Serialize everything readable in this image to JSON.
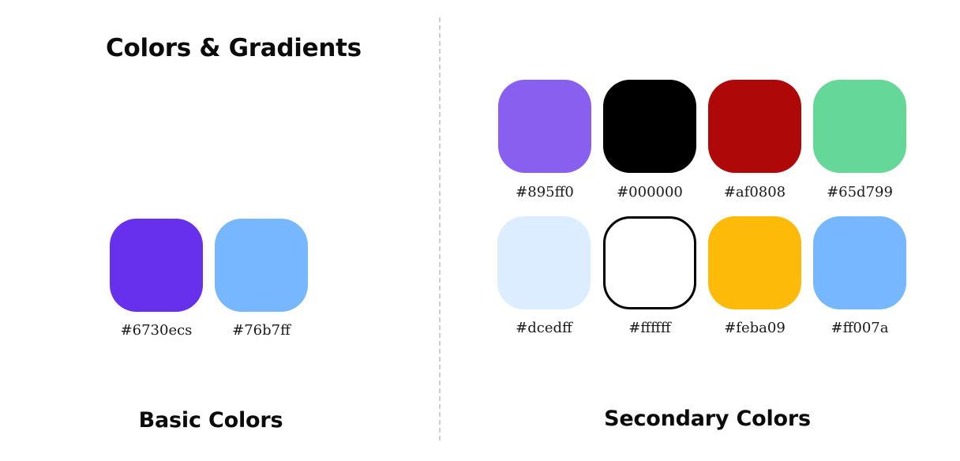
{
  "page": {
    "title": "Colors & Gradients"
  },
  "basic": {
    "heading": "Basic Colors",
    "swatches": [
      {
        "label": "#6730ecs",
        "color": "#6730ec"
      },
      {
        "label": "#76b7ff",
        "color": "#76b7ff"
      }
    ]
  },
  "secondary": {
    "heading": "Secondary Colors",
    "swatches": [
      {
        "label": "#895ff0",
        "color": "#895ff0"
      },
      {
        "label": "#000000",
        "color": "#000000"
      },
      {
        "label": "#af0808",
        "color": "#af0808"
      },
      {
        "label": "#65d799",
        "color": "#65d799"
      },
      {
        "label": "#dcedff",
        "color": "#dcedff"
      },
      {
        "label": "#ffffff",
        "color": "#ffffff"
      },
      {
        "label": "#feba09",
        "color": "#feba09"
      },
      {
        "label": "#ff007a",
        "color": "#76b7ff"
      }
    ]
  }
}
